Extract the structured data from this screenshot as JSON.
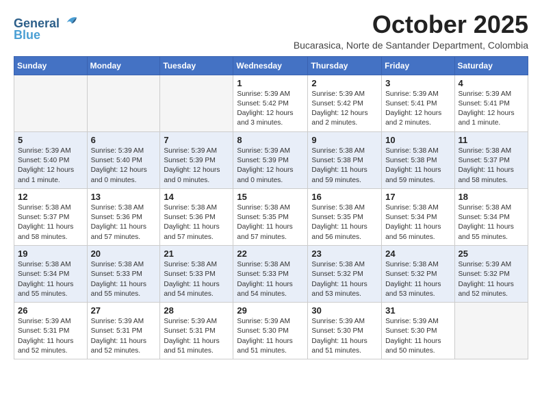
{
  "header": {
    "logo_line1": "General",
    "logo_line2": "Blue",
    "month": "October 2025",
    "location": "Bucarasica, Norte de Santander Department, Colombia"
  },
  "days_of_week": [
    "Sunday",
    "Monday",
    "Tuesday",
    "Wednesday",
    "Thursday",
    "Friday",
    "Saturday"
  ],
  "weeks": [
    [
      {
        "day": "",
        "info": ""
      },
      {
        "day": "",
        "info": ""
      },
      {
        "day": "",
        "info": ""
      },
      {
        "day": "1",
        "info": "Sunrise: 5:39 AM\nSunset: 5:42 PM\nDaylight: 12 hours\nand 3 minutes."
      },
      {
        "day": "2",
        "info": "Sunrise: 5:39 AM\nSunset: 5:42 PM\nDaylight: 12 hours\nand 2 minutes."
      },
      {
        "day": "3",
        "info": "Sunrise: 5:39 AM\nSunset: 5:41 PM\nDaylight: 12 hours\nand 2 minutes."
      },
      {
        "day": "4",
        "info": "Sunrise: 5:39 AM\nSunset: 5:41 PM\nDaylight: 12 hours\nand 1 minute."
      }
    ],
    [
      {
        "day": "5",
        "info": "Sunrise: 5:39 AM\nSunset: 5:40 PM\nDaylight: 12 hours\nand 1 minute."
      },
      {
        "day": "6",
        "info": "Sunrise: 5:39 AM\nSunset: 5:40 PM\nDaylight: 12 hours\nand 0 minutes."
      },
      {
        "day": "7",
        "info": "Sunrise: 5:39 AM\nSunset: 5:39 PM\nDaylight: 12 hours\nand 0 minutes."
      },
      {
        "day": "8",
        "info": "Sunrise: 5:39 AM\nSunset: 5:39 PM\nDaylight: 12 hours\nand 0 minutes."
      },
      {
        "day": "9",
        "info": "Sunrise: 5:38 AM\nSunset: 5:38 PM\nDaylight: 11 hours\nand 59 minutes."
      },
      {
        "day": "10",
        "info": "Sunrise: 5:38 AM\nSunset: 5:38 PM\nDaylight: 11 hours\nand 59 minutes."
      },
      {
        "day": "11",
        "info": "Sunrise: 5:38 AM\nSunset: 5:37 PM\nDaylight: 11 hours\nand 58 minutes."
      }
    ],
    [
      {
        "day": "12",
        "info": "Sunrise: 5:38 AM\nSunset: 5:37 PM\nDaylight: 11 hours\nand 58 minutes."
      },
      {
        "day": "13",
        "info": "Sunrise: 5:38 AM\nSunset: 5:36 PM\nDaylight: 11 hours\nand 57 minutes."
      },
      {
        "day": "14",
        "info": "Sunrise: 5:38 AM\nSunset: 5:36 PM\nDaylight: 11 hours\nand 57 minutes."
      },
      {
        "day": "15",
        "info": "Sunrise: 5:38 AM\nSunset: 5:35 PM\nDaylight: 11 hours\nand 57 minutes."
      },
      {
        "day": "16",
        "info": "Sunrise: 5:38 AM\nSunset: 5:35 PM\nDaylight: 11 hours\nand 56 minutes."
      },
      {
        "day": "17",
        "info": "Sunrise: 5:38 AM\nSunset: 5:34 PM\nDaylight: 11 hours\nand 56 minutes."
      },
      {
        "day": "18",
        "info": "Sunrise: 5:38 AM\nSunset: 5:34 PM\nDaylight: 11 hours\nand 55 minutes."
      }
    ],
    [
      {
        "day": "19",
        "info": "Sunrise: 5:38 AM\nSunset: 5:34 PM\nDaylight: 11 hours\nand 55 minutes."
      },
      {
        "day": "20",
        "info": "Sunrise: 5:38 AM\nSunset: 5:33 PM\nDaylight: 11 hours\nand 55 minutes."
      },
      {
        "day": "21",
        "info": "Sunrise: 5:38 AM\nSunset: 5:33 PM\nDaylight: 11 hours\nand 54 minutes."
      },
      {
        "day": "22",
        "info": "Sunrise: 5:38 AM\nSunset: 5:33 PM\nDaylight: 11 hours\nand 54 minutes."
      },
      {
        "day": "23",
        "info": "Sunrise: 5:38 AM\nSunset: 5:32 PM\nDaylight: 11 hours\nand 53 minutes."
      },
      {
        "day": "24",
        "info": "Sunrise: 5:38 AM\nSunset: 5:32 PM\nDaylight: 11 hours\nand 53 minutes."
      },
      {
        "day": "25",
        "info": "Sunrise: 5:39 AM\nSunset: 5:32 PM\nDaylight: 11 hours\nand 52 minutes."
      }
    ],
    [
      {
        "day": "26",
        "info": "Sunrise: 5:39 AM\nSunset: 5:31 PM\nDaylight: 11 hours\nand 52 minutes."
      },
      {
        "day": "27",
        "info": "Sunrise: 5:39 AM\nSunset: 5:31 PM\nDaylight: 11 hours\nand 52 minutes."
      },
      {
        "day": "28",
        "info": "Sunrise: 5:39 AM\nSunset: 5:31 PM\nDaylight: 11 hours\nand 51 minutes."
      },
      {
        "day": "29",
        "info": "Sunrise: 5:39 AM\nSunset: 5:30 PM\nDaylight: 11 hours\nand 51 minutes."
      },
      {
        "day": "30",
        "info": "Sunrise: 5:39 AM\nSunset: 5:30 PM\nDaylight: 11 hours\nand 51 minutes."
      },
      {
        "day": "31",
        "info": "Sunrise: 5:39 AM\nSunset: 5:30 PM\nDaylight: 11 hours\nand 50 minutes."
      },
      {
        "day": "",
        "info": ""
      }
    ]
  ]
}
